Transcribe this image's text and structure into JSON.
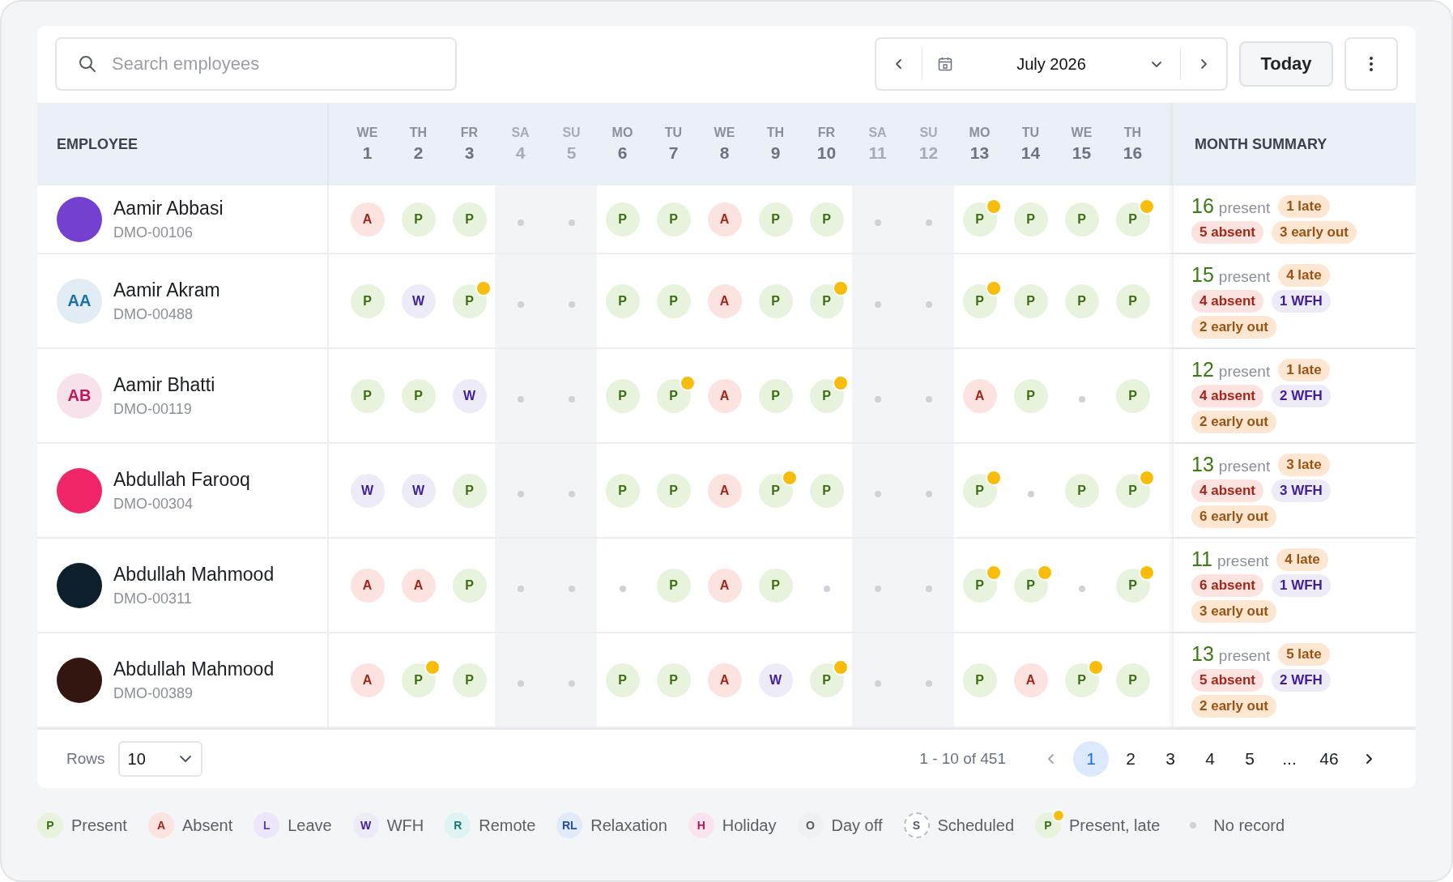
{
  "toolbar": {
    "search": {
      "placeholder": "Search employees"
    },
    "month": "July 2026",
    "today_button": "Today"
  },
  "header": {
    "employee": "EMPLOYEE",
    "summary": "MONTH SUMMARY",
    "days": [
      {
        "dow": "WE",
        "num": "1",
        "weekend": false
      },
      {
        "dow": "TH",
        "num": "2",
        "weekend": false
      },
      {
        "dow": "FR",
        "num": "3",
        "weekend": false
      },
      {
        "dow": "SA",
        "num": "4",
        "weekend": true
      },
      {
        "dow": "SU",
        "num": "5",
        "weekend": true
      },
      {
        "dow": "MO",
        "num": "6",
        "weekend": false
      },
      {
        "dow": "TU",
        "num": "7",
        "weekend": false
      },
      {
        "dow": "WE",
        "num": "8",
        "weekend": false
      },
      {
        "dow": "TH",
        "num": "9",
        "weekend": false
      },
      {
        "dow": "FR",
        "num": "10",
        "weekend": false
      },
      {
        "dow": "SA",
        "num": "11",
        "weekend": true
      },
      {
        "dow": "SU",
        "num": "12",
        "weekend": true
      },
      {
        "dow": "MO",
        "num": "13",
        "weekend": false
      },
      {
        "dow": "TU",
        "num": "14",
        "weekend": false
      },
      {
        "dow": "WE",
        "num": "15",
        "weekend": false
      },
      {
        "dow": "TH",
        "num": "16",
        "weekend": false
      }
    ]
  },
  "rows": [
    {
      "name": "Aamir Abbasi",
      "id": "DMO-00106",
      "avatar": {
        "kind": "solid",
        "color": "#7440cf"
      },
      "days": [
        {
          "kind": "absent",
          "letter": "A",
          "late": false
        },
        {
          "kind": "present",
          "letter": "P",
          "late": false
        },
        {
          "kind": "present",
          "letter": "P",
          "late": false
        },
        {
          "kind": "none",
          "late": false
        },
        {
          "kind": "none",
          "late": false
        },
        {
          "kind": "present",
          "letter": "P",
          "late": false
        },
        {
          "kind": "present",
          "letter": "P",
          "late": false
        },
        {
          "kind": "absent",
          "letter": "A",
          "late": false
        },
        {
          "kind": "present",
          "letter": "P",
          "late": false
        },
        {
          "kind": "present",
          "letter": "P",
          "late": false
        },
        {
          "kind": "none",
          "late": false
        },
        {
          "kind": "none",
          "late": false
        },
        {
          "kind": "present",
          "letter": "P",
          "late": true
        },
        {
          "kind": "present",
          "letter": "P",
          "late": false
        },
        {
          "kind": "present",
          "letter": "P",
          "late": false
        },
        {
          "kind": "present",
          "letter": "P",
          "late": true
        }
      ],
      "summary": {
        "present": "16",
        "present_label": "present",
        "tags": [
          {
            "kind": "late",
            "text": "1 late"
          },
          {
            "kind": "absent",
            "text": "5 absent"
          },
          {
            "kind": "early",
            "text": "3 early out"
          }
        ]
      }
    },
    {
      "name": "Aamir Akram",
      "id": "DMO-00488",
      "avatar": {
        "kind": "initials",
        "initials": "AA",
        "color": "#1a6fa8"
      },
      "days": [
        {
          "kind": "present",
          "letter": "P",
          "late": false
        },
        {
          "kind": "wfh",
          "letter": "W",
          "late": false
        },
        {
          "kind": "present",
          "letter": "P",
          "late": true
        },
        {
          "kind": "none",
          "late": false
        },
        {
          "kind": "none",
          "late": false
        },
        {
          "kind": "present",
          "letter": "P",
          "late": false
        },
        {
          "kind": "present",
          "letter": "P",
          "late": false
        },
        {
          "kind": "absent",
          "letter": "A",
          "late": false
        },
        {
          "kind": "present",
          "letter": "P",
          "late": false
        },
        {
          "kind": "present",
          "letter": "P",
          "late": true
        },
        {
          "kind": "none",
          "late": false
        },
        {
          "kind": "none",
          "late": false
        },
        {
          "kind": "present",
          "letter": "P",
          "late": true
        },
        {
          "kind": "present",
          "letter": "P",
          "late": false
        },
        {
          "kind": "present",
          "letter": "P",
          "late": false
        },
        {
          "kind": "present",
          "letter": "P",
          "late": false
        }
      ],
      "summary": {
        "present": "15",
        "present_label": "present",
        "tags": [
          {
            "kind": "late",
            "text": "4 late"
          },
          {
            "kind": "absent",
            "text": "4 absent"
          },
          {
            "kind": "wfh",
            "text": "1 WFH"
          },
          {
            "kind": "early",
            "text": "2 early out"
          }
        ]
      }
    },
    {
      "name": "Aamir Bhatti",
      "id": "DMO-00119",
      "avatar": {
        "kind": "initials",
        "initials": "AB",
        "color": "#c2185b"
      },
      "days": [
        {
          "kind": "present",
          "letter": "P",
          "late": false
        },
        {
          "kind": "present",
          "letter": "P",
          "late": false
        },
        {
          "kind": "wfh",
          "letter": "W",
          "late": false
        },
        {
          "kind": "none",
          "late": false
        },
        {
          "kind": "none",
          "late": false
        },
        {
          "kind": "present",
          "letter": "P",
          "late": false
        },
        {
          "kind": "present",
          "letter": "P",
          "late": true
        },
        {
          "kind": "absent",
          "letter": "A",
          "late": false
        },
        {
          "kind": "present",
          "letter": "P",
          "late": false
        },
        {
          "kind": "present",
          "letter": "P",
          "late": true
        },
        {
          "kind": "none",
          "late": false
        },
        {
          "kind": "none",
          "late": false
        },
        {
          "kind": "absent",
          "letter": "A",
          "late": false
        },
        {
          "kind": "present",
          "letter": "P",
          "late": false
        },
        {
          "kind": "none",
          "late": false
        },
        {
          "kind": "present",
          "letter": "P",
          "late": false
        }
      ],
      "summary": {
        "present": "12",
        "present_label": "present",
        "tags": [
          {
            "kind": "late",
            "text": "1 late"
          },
          {
            "kind": "absent",
            "text": "4 absent"
          },
          {
            "kind": "wfh",
            "text": "2 WFH"
          },
          {
            "kind": "early",
            "text": "2 early out"
          }
        ]
      }
    },
    {
      "name": "Abdullah Farooq",
      "id": "DMO-00304",
      "avatar": {
        "kind": "solid",
        "color": "#ef2568"
      },
      "days": [
        {
          "kind": "wfh",
          "letter": "W",
          "late": false
        },
        {
          "kind": "wfh",
          "letter": "W",
          "late": false
        },
        {
          "kind": "present",
          "letter": "P",
          "late": false
        },
        {
          "kind": "none",
          "late": false
        },
        {
          "kind": "none",
          "late": false
        },
        {
          "kind": "present",
          "letter": "P",
          "late": false
        },
        {
          "kind": "present",
          "letter": "P",
          "late": false
        },
        {
          "kind": "absent",
          "letter": "A",
          "late": false
        },
        {
          "kind": "present",
          "letter": "P",
          "late": true
        },
        {
          "kind": "present",
          "letter": "P",
          "late": false
        },
        {
          "kind": "none",
          "late": false
        },
        {
          "kind": "none",
          "late": false
        },
        {
          "kind": "present",
          "letter": "P",
          "late": true
        },
        {
          "kind": "none",
          "late": false
        },
        {
          "kind": "present",
          "letter": "P",
          "late": false
        },
        {
          "kind": "present",
          "letter": "P",
          "late": true
        }
      ],
      "summary": {
        "present": "13",
        "present_label": "present",
        "tags": [
          {
            "kind": "late",
            "text": "3 late"
          },
          {
            "kind": "absent",
            "text": "4 absent"
          },
          {
            "kind": "wfh",
            "text": "3 WFH"
          },
          {
            "kind": "early",
            "text": "6 early out"
          }
        ]
      }
    },
    {
      "name": "Abdullah Mahmood",
      "id": "DMO-00311",
      "avatar": {
        "kind": "solid",
        "color": "#0c1f2a"
      },
      "days": [
        {
          "kind": "absent",
          "letter": "A",
          "late": false
        },
        {
          "kind": "absent",
          "letter": "A",
          "late": false
        },
        {
          "kind": "present",
          "letter": "P",
          "late": false
        },
        {
          "kind": "none",
          "late": false
        },
        {
          "kind": "none",
          "late": false
        },
        {
          "kind": "none",
          "late": false
        },
        {
          "kind": "present",
          "letter": "P",
          "late": false
        },
        {
          "kind": "absent",
          "letter": "A",
          "late": false
        },
        {
          "kind": "present",
          "letter": "P",
          "late": false
        },
        {
          "kind": "none",
          "late": false
        },
        {
          "kind": "none",
          "late": false
        },
        {
          "kind": "none",
          "late": false
        },
        {
          "kind": "present",
          "letter": "P",
          "late": true
        },
        {
          "kind": "present",
          "letter": "P",
          "late": true
        },
        {
          "kind": "none",
          "late": false
        },
        {
          "kind": "present",
          "letter": "P",
          "late": true
        }
      ],
      "summary": {
        "present": "11",
        "present_label": "present",
        "tags": [
          {
            "kind": "late",
            "text": "4 late"
          },
          {
            "kind": "absent",
            "text": "6 absent"
          },
          {
            "kind": "wfh",
            "text": "1 WFH"
          },
          {
            "kind": "early",
            "text": "3 early out"
          }
        ]
      }
    },
    {
      "name": "Abdullah Mahmood",
      "id": "DMO-00389",
      "avatar": {
        "kind": "solid",
        "color": "#331610"
      },
      "days": [
        {
          "kind": "absent",
          "letter": "A",
          "late": false
        },
        {
          "kind": "present",
          "letter": "P",
          "late": true
        },
        {
          "kind": "present",
          "letter": "P",
          "late": false
        },
        {
          "kind": "none",
          "late": false
        },
        {
          "kind": "none",
          "late": false
        },
        {
          "kind": "present",
          "letter": "P",
          "late": false
        },
        {
          "kind": "present",
          "letter": "P",
          "late": false
        },
        {
          "kind": "absent",
          "letter": "A",
          "late": false
        },
        {
          "kind": "wfh",
          "letter": "W",
          "late": false
        },
        {
          "kind": "present",
          "letter": "P",
          "late": true
        },
        {
          "kind": "none",
          "late": false
        },
        {
          "kind": "none",
          "late": false
        },
        {
          "kind": "present",
          "letter": "P",
          "late": false
        },
        {
          "kind": "absent",
          "letter": "A",
          "late": false
        },
        {
          "kind": "present",
          "letter": "P",
          "late": true
        },
        {
          "kind": "present",
          "letter": "P",
          "late": false
        }
      ],
      "summary": {
        "present": "13",
        "present_label": "present",
        "tags": [
          {
            "kind": "late",
            "text": "5 late"
          },
          {
            "kind": "absent",
            "text": "5 absent"
          },
          {
            "kind": "wfh",
            "text": "2 WFH"
          },
          {
            "kind": "early",
            "text": "2 early out"
          }
        ]
      }
    }
  ],
  "footer": {
    "rows_label": "Rows",
    "rows_value": "10",
    "range": "1 - 10 of 451",
    "pages": [
      {
        "kind": "page",
        "label": "1",
        "selected": true
      },
      {
        "kind": "page",
        "label": "2",
        "selected": false
      },
      {
        "kind": "page",
        "label": "3",
        "selected": false
      },
      {
        "kind": "page",
        "label": "4",
        "selected": false
      },
      {
        "kind": "page",
        "label": "5",
        "selected": false
      },
      {
        "kind": "ellipsis",
        "label": "..."
      },
      {
        "kind": "page",
        "label": "46",
        "selected": false
      }
    ]
  },
  "legend": [
    {
      "kind": "present",
      "letter": "P",
      "label": "Present",
      "late": false
    },
    {
      "kind": "absent",
      "letter": "A",
      "label": "Absent",
      "late": false
    },
    {
      "kind": "leave",
      "letter": "L",
      "label": "Leave",
      "late": false
    },
    {
      "kind": "wfh",
      "letter": "W",
      "label": "WFH",
      "late": false
    },
    {
      "kind": "remote",
      "letter": "R",
      "label": "Remote",
      "late": false
    },
    {
      "kind": "relaxation",
      "letter": "RL",
      "label": "Relaxation",
      "late": false
    },
    {
      "kind": "holiday",
      "letter": "H",
      "label": "Holiday",
      "late": false
    },
    {
      "kind": "dayoff",
      "letter": "O",
      "label": "Day off",
      "late": false
    },
    {
      "kind": "scheduled",
      "letter": "S",
      "label": "Scheduled",
      "late": false
    },
    {
      "kind": "present",
      "letter": "P",
      "label": "Present, late",
      "late": true
    },
    {
      "kind": "none",
      "label": "No record",
      "late": false
    }
  ]
}
